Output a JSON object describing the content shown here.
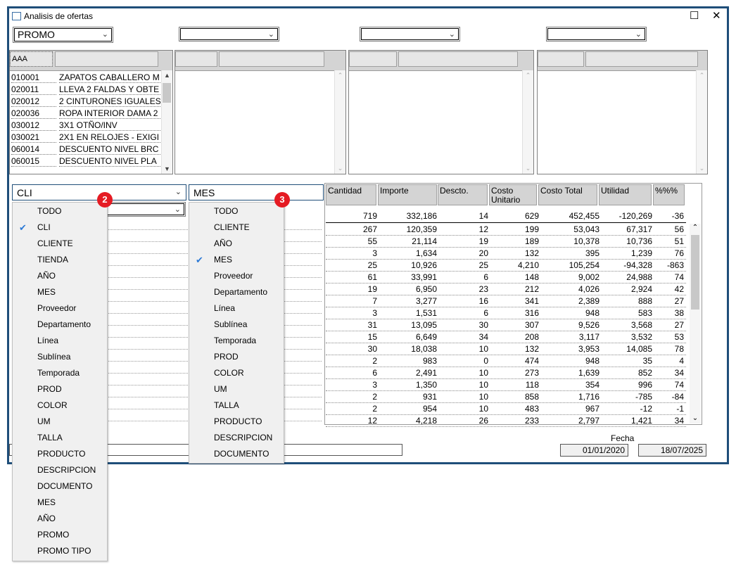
{
  "window": {
    "title": "Analisis de ofertas",
    "maximize_glyph": "☐",
    "close_glyph": "✕"
  },
  "filters": {
    "promo_value": "PROMO",
    "combo2_value": "",
    "combo3_value": "",
    "combo4_value": ""
  },
  "panel1": {
    "header": "AAA",
    "rows": [
      {
        "code": "010001",
        "desc": "ZAPATOS CABALLERO M"
      },
      {
        "code": "020011",
        "desc": "LLEVA 2 FALDAS Y OBTE"
      },
      {
        "code": "020012",
        "desc": "2 CINTURONES IGUALES"
      },
      {
        "code": "020036",
        "desc": "ROPA INTERIOR DAMA 2"
      },
      {
        "code": "030012",
        "desc": "3X1 OTÑO/INV"
      },
      {
        "code": "030021",
        "desc": "2X1 EN RELOJES - EXIGI"
      },
      {
        "code": "060014",
        "desc": "DESCUENTO NIVEL BRC"
      },
      {
        "code": "060015",
        "desc": "DESCUENTO NIVEL PLA"
      }
    ]
  },
  "groupby": {
    "combo_a": "CLI",
    "combo_b": "MES"
  },
  "menu_a": {
    "badge": "2",
    "checked": "CLI",
    "items": [
      "TODO",
      "CLI",
      "CLIENTE",
      "TIENDA",
      "AÑO",
      "MES",
      "Proveedor",
      "Departamento",
      "Línea",
      "Sublínea",
      "Temporada",
      "PROD",
      "COLOR",
      "UM",
      "TALLA",
      "PRODUCTO",
      "DESCRIPCION",
      "DOCUMENTO",
      "MES",
      "AÑO",
      "PROMO",
      "PROMO TIPO"
    ]
  },
  "menu_b": {
    "badge": "3",
    "checked": "MES",
    "items": [
      "TODO",
      "CLIENTE",
      "AÑO",
      "MES",
      "Proveedor",
      "Departamento",
      "Línea",
      "Sublínea",
      "Temporada",
      "PROD",
      "COLOR",
      "UM",
      "TALLA",
      "PRODUCTO",
      "DESCRIPCION",
      "DOCUMENTO"
    ]
  },
  "grid": {
    "headers": [
      {
        "label": "Cantidad"
      },
      {
        "label": "Importe"
      },
      {
        "label": "Descto."
      },
      {
        "label": "Costo Unitario"
      },
      {
        "label": "Costo Total"
      },
      {
        "label": "Utilidad"
      },
      {
        "label": "%%%"
      }
    ],
    "totals": [
      "719",
      "332,186",
      "14",
      "629",
      "452,455",
      "-120,269",
      "-36"
    ],
    "rows": [
      [
        "267",
        "120,359",
        "12",
        "199",
        "53,043",
        "67,317",
        "56"
      ],
      [
        "55",
        "21,114",
        "19",
        "189",
        "10,378",
        "10,736",
        "51"
      ],
      [
        "3",
        "1,634",
        "20",
        "132",
        "395",
        "1,239",
        "76"
      ],
      [
        "25",
        "10,926",
        "25",
        "4,210",
        "105,254",
        "-94,328",
        "-863"
      ],
      [
        "61",
        "33,991",
        "6",
        "148",
        "9,002",
        "24,988",
        "74"
      ],
      [
        "19",
        "6,950",
        "23",
        "212",
        "4,026",
        "2,924",
        "42"
      ],
      [
        "7",
        "3,277",
        "16",
        "341",
        "2,389",
        "888",
        "27"
      ],
      [
        "3",
        "1,531",
        "6",
        "316",
        "948",
        "583",
        "38"
      ],
      [
        "31",
        "13,095",
        "30",
        "307",
        "9,526",
        "3,568",
        "27"
      ],
      [
        "15",
        "6,649",
        "34",
        "208",
        "3,117",
        "3,532",
        "53"
      ],
      [
        "30",
        "18,038",
        "10",
        "132",
        "3,953",
        "14,085",
        "78"
      ],
      [
        "2",
        "983",
        "0",
        "474",
        "948",
        "35",
        "4"
      ],
      [
        "6",
        "2,491",
        "10",
        "273",
        "1,639",
        "852",
        "34"
      ],
      [
        "3",
        "1,350",
        "10",
        "118",
        "354",
        "996",
        "74"
      ],
      [
        "2",
        "931",
        "10",
        "858",
        "1,716",
        "-785",
        "-84"
      ],
      [
        "2",
        "954",
        "10",
        "483",
        "967",
        "-12",
        "-1"
      ],
      [
        "12",
        "4,218",
        "26",
        "233",
        "2,797",
        "1,421",
        "34"
      ]
    ]
  },
  "dates": {
    "label": "Fecha",
    "from": "01/01/2020",
    "to": "18/07/2025"
  }
}
